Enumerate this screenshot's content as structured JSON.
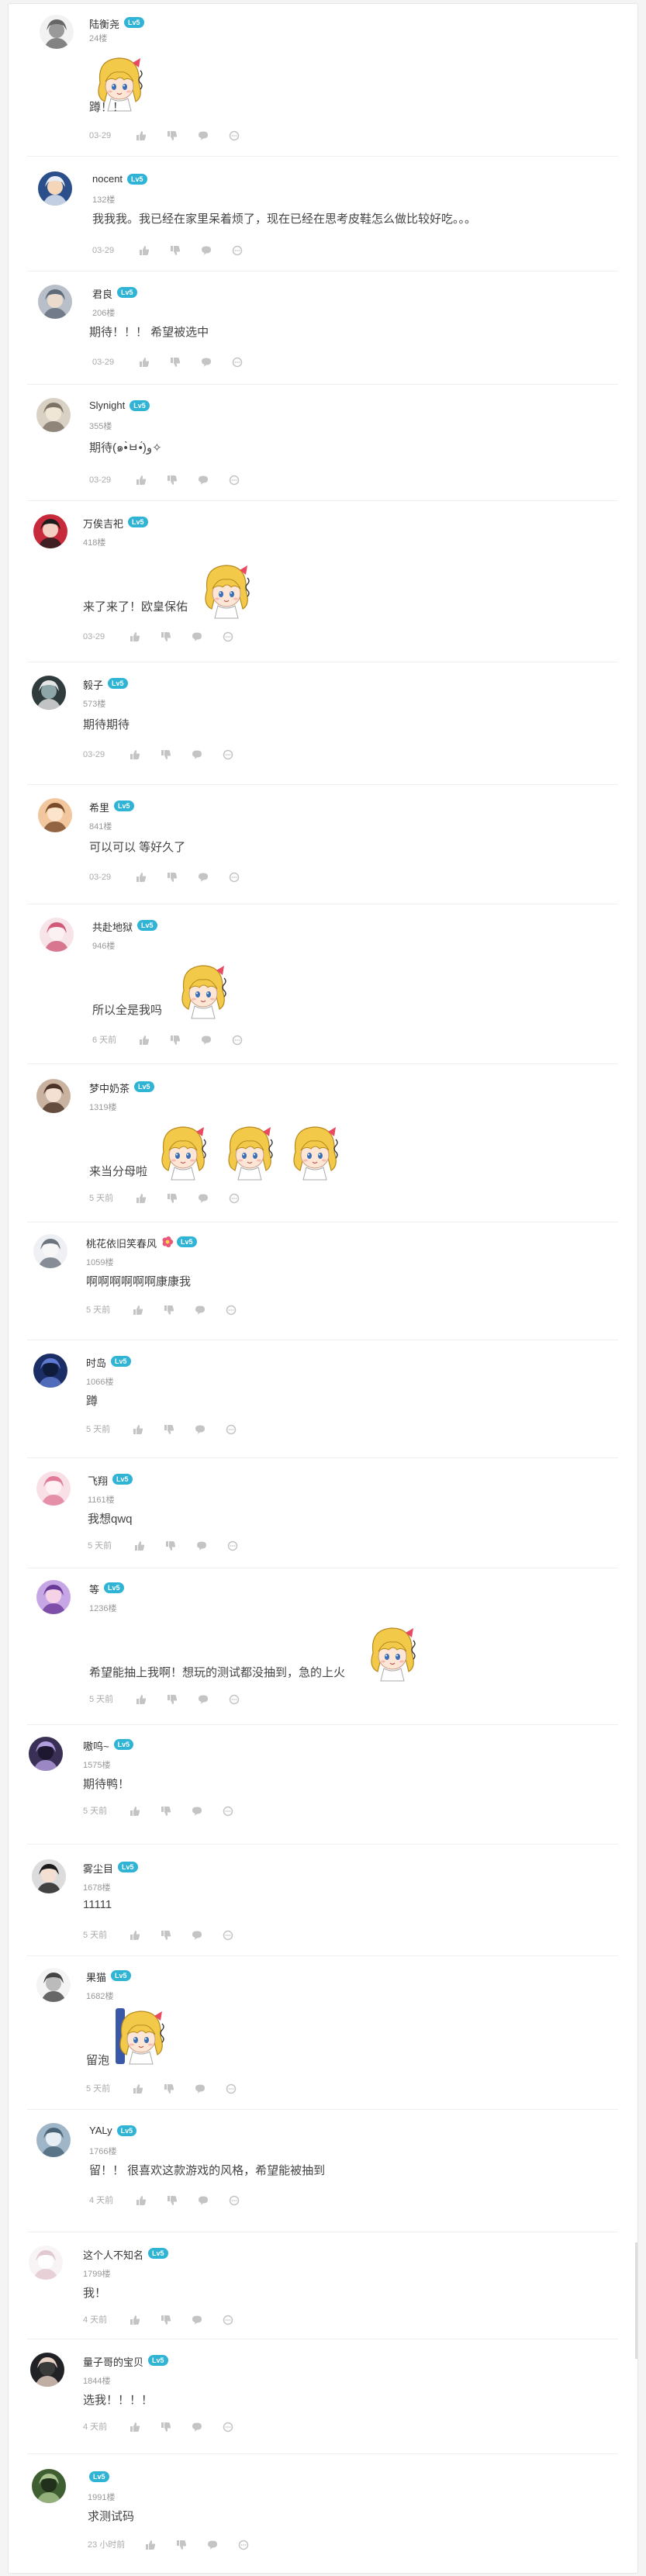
{
  "comments": [
    {
      "username": "陆衡尧",
      "level": "Lv5",
      "floor": "24楼",
      "text": "蹲！！",
      "date": "03-29",
      "avatar": "avatar-sketch"
    },
    {
      "username": "nocent",
      "level": "Lv5",
      "floor": "132楼",
      "text": "我我我。我已经在家里呆着烦了，现在已经在思考皮鞋怎么做比较好吃。。。",
      "date": "03-29",
      "avatar": "avatar-white-hair"
    },
    {
      "username": "君良",
      "level": "Lv5",
      "floor": "206楼",
      "text": "期待！！！ 希望被选中",
      "date": "03-29",
      "avatar": "avatar-grey-char"
    },
    {
      "username": "Slynight",
      "level": "Lv5",
      "floor": "355楼",
      "text": "期待(๑•̀ㅂ•́)و✧",
      "date": "03-29",
      "avatar": "avatar-beige"
    },
    {
      "username": "万俟吉祀",
      "level": "Lv5",
      "floor": "418楼",
      "text": "来了来了！欧皇保佑",
      "date": "03-29",
      "avatar": "avatar-red"
    },
    {
      "username": "毅子",
      "level": "Lv5",
      "floor": "573楼",
      "text": "期待期待",
      "date": "03-29",
      "avatar": "avatar-dark-char"
    },
    {
      "username": "希里",
      "level": "Lv5",
      "floor": "841楼",
      "text": "可以可以  等好久了",
      "date": "03-29",
      "avatar": "avatar-orange-char"
    },
    {
      "username": "共赴地狱",
      "level": "Lv5",
      "floor": "946楼",
      "text": "所以全是我吗",
      "date": "6 天前",
      "avatar": "avatar-pink"
    },
    {
      "username": "梦中奶茶",
      "level": "Lv5",
      "floor": "1319楼",
      "text": "来当分母啦",
      "date": "5 天前",
      "avatar": "avatar-brown-char"
    },
    {
      "username": "桃花依旧笑春风",
      "level": "Lv5",
      "floor": "1059楼",
      "text": "啊啊啊啊啊啊康康我",
      "date": "5 天前",
      "avatar": "avatar-white-char"
    },
    {
      "username": "时岛",
      "level": "Lv5",
      "floor": "1066楼",
      "text": "蹲",
      "date": "5 天前",
      "avatar": "avatar-navy"
    },
    {
      "username": "飞翔",
      "level": "Lv5",
      "floor": "1161楼",
      "text": "我想qwq",
      "date": "5 天前",
      "avatar": "avatar-light-pink"
    },
    {
      "username": "等",
      "level": "Lv5",
      "floor": "1236楼",
      "text": "希望能抽上我啊！想玩的测试都没抽到，急的上火",
      "date": "5 天前",
      "avatar": "avatar-purple"
    },
    {
      "username": "嗷呜~",
      "level": "Lv5",
      "floor": "1575楼",
      "text": "期待鸭！",
      "date": "5 天前",
      "avatar": "avatar-dark-purple"
    },
    {
      "username": "雾尘目",
      "level": "Lv5",
      "floor": "1678楼",
      "text": "11111",
      "date": "5 天前",
      "avatar": "avatar-black-char"
    },
    {
      "username": "果猫",
      "level": "Lv5",
      "floor": "1682楼",
      "text": "留泡",
      "date": "5 天前",
      "avatar": "avatar-sketch-2"
    },
    {
      "username": "YALy",
      "level": "Lv5",
      "floor": "1766楼",
      "text": "留！！ 很喜欢这款游戏的风格，希望能被抽到",
      "date": "4 天前",
      "avatar": "avatar-blue-grey"
    },
    {
      "username": "这个人不知名",
      "level": "Lv5",
      "floor": "1799楼",
      "text": "我！",
      "date": "4 天前",
      "avatar": "avatar-faint"
    },
    {
      "username": "量子哥的宝贝",
      "level": "Lv5",
      "floor": "1844楼",
      "text": "选我！！！！",
      "date": "4 天前",
      "avatar": "avatar-dark-face"
    },
    {
      "username": "",
      "level": "Lv5",
      "floor": "1991楼",
      "text": "求测试码",
      "date": "23 小时前",
      "avatar": "avatar-green"
    }
  ],
  "colors": {
    "level_badge": "#2fb4d6",
    "icon": "#c4c4c4",
    "border": "#eeeeee"
  },
  "icons": [
    "thumbs-up-icon",
    "thumbs-down-icon",
    "reply-icon",
    "more-icon"
  ]
}
